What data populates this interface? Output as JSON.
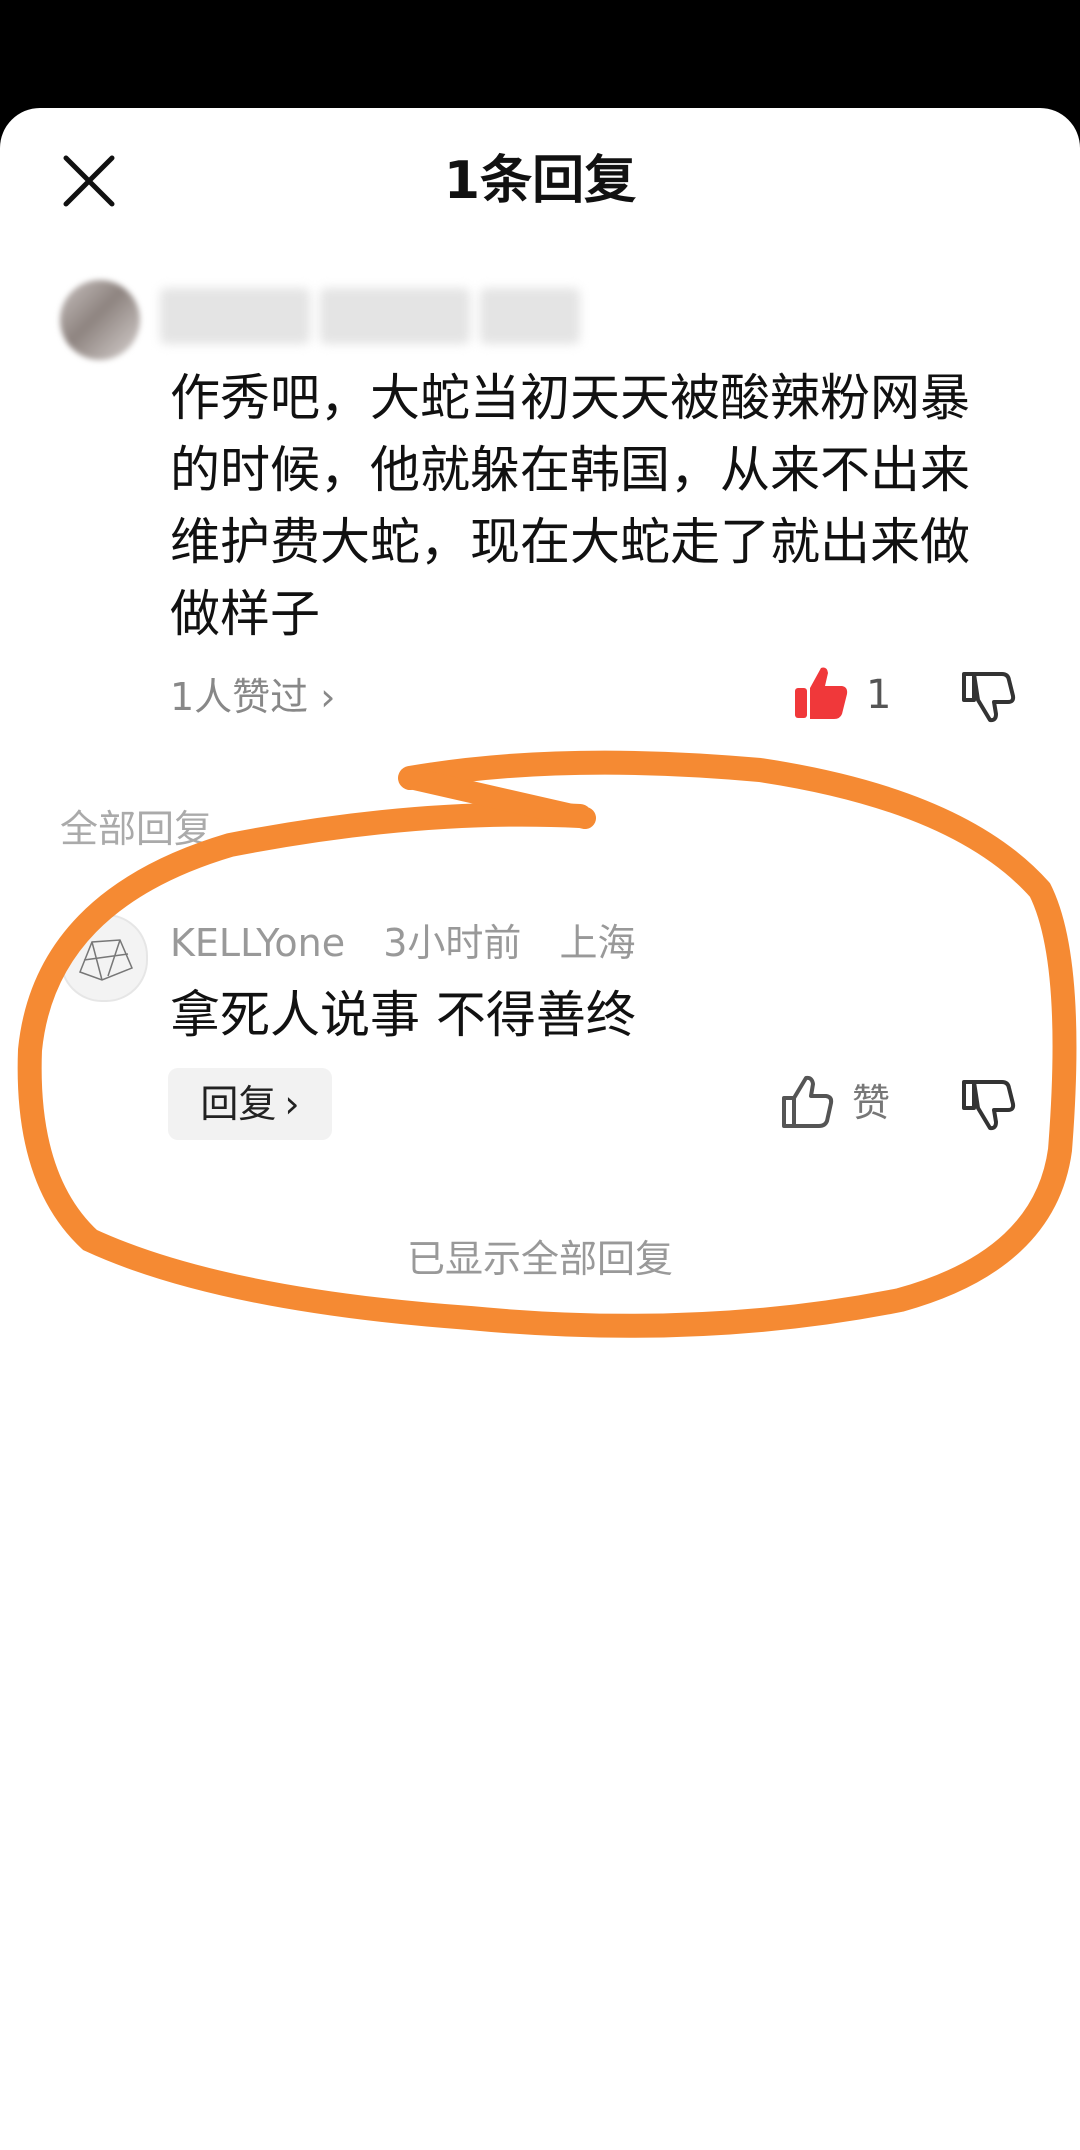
{
  "header": {
    "title": "1条回复"
  },
  "comment": {
    "text": "作秀吧，大蛇当初天天被酸辣粉网暴的时候，他就躲在韩国，从来不出来维护费大蛇，现在大蛇走了就出来做做样子",
    "likers_label": "1人赞过",
    "like_count": "1"
  },
  "section": {
    "label": "全部回复"
  },
  "reply": {
    "username": "KELLYone",
    "time": "3小时前",
    "location": "上海",
    "text": "拿死人说事 不得善终",
    "reply_button": "回复",
    "like_label": "赞"
  },
  "footer": {
    "all_shown": "已显示全部回复"
  },
  "colors": {
    "like_active": "#f0383a",
    "annotation": "#f58a33"
  },
  "icons": [
    "close-icon",
    "thumbs-up-icon",
    "thumbs-down-icon",
    "chevron-right-icon"
  ]
}
